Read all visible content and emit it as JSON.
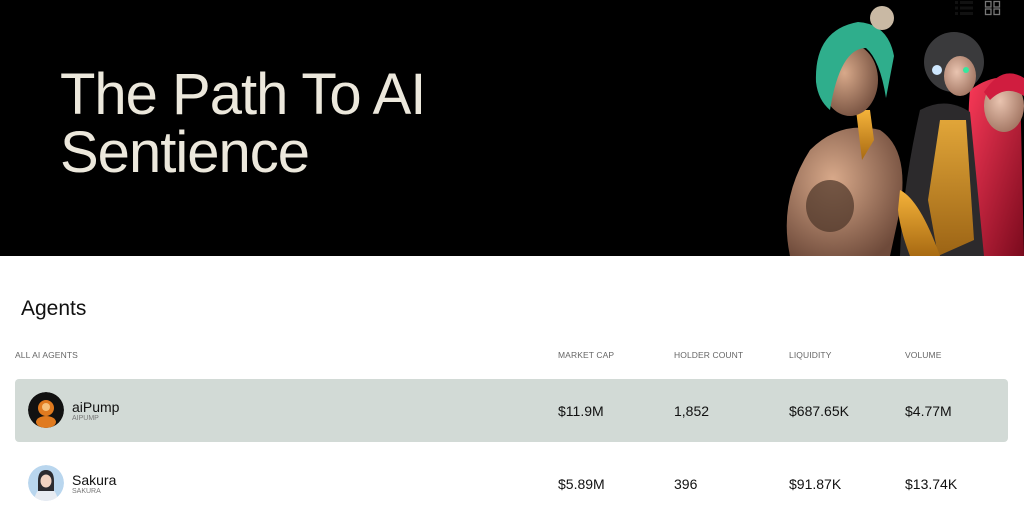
{
  "hero": {
    "title": "The Path To AI\nSentience"
  },
  "agents_section": {
    "title": "Agents",
    "view_modes": [
      "list",
      "grid"
    ],
    "active_view": "list",
    "columns": {
      "name": "ALL AI AGENTS",
      "market_cap": "MARKET CAP",
      "holder_count": "HOLDER COUNT",
      "liquidity": "LIQUIDITY",
      "volume": "VOLUME"
    },
    "rows": [
      {
        "name": "aiPump",
        "ticker": "AIPUMP",
        "market_cap": "$11.9M",
        "holder_count": "1,852",
        "liquidity": "$687.65K",
        "volume": "$4.77M",
        "selected": true
      },
      {
        "name": "Sakura",
        "ticker": "SAKURA",
        "market_cap": "$5.89M",
        "holder_count": "396",
        "liquidity": "$91.87K",
        "volume": "$13.74K",
        "selected": false
      }
    ]
  },
  "colors": {
    "hero_bg": "#000000",
    "hero_text": "#ece8dc",
    "selected_row": "#d2dad6"
  }
}
